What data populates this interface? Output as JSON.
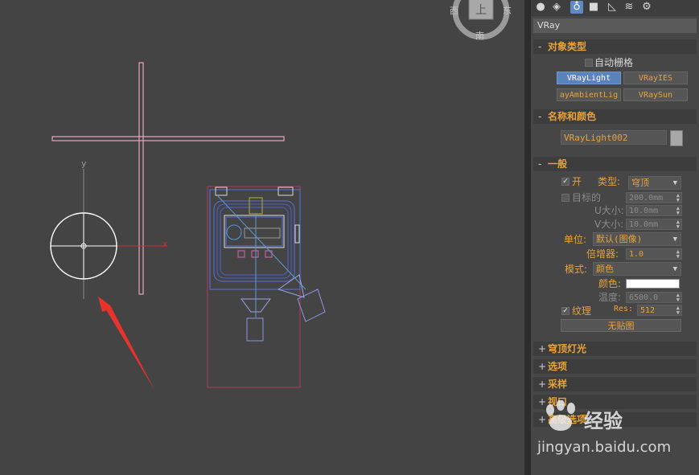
{
  "viewcube": {
    "west": "西",
    "east": "东",
    "south": "南",
    "face": "上"
  },
  "viewport": {
    "axis_y": "y",
    "axis_x": "x"
  },
  "tabs": [
    {
      "icon": "create-sphere-icon"
    },
    {
      "icon": "shapes-icon"
    },
    {
      "icon": "lights-icon"
    },
    {
      "icon": "cameras-icon"
    },
    {
      "icon": "helpers-icon"
    },
    {
      "icon": "spacewarps-icon"
    },
    {
      "icon": "systems-icon"
    }
  ],
  "category": "VRay",
  "object_type": {
    "header": "对象类型",
    "autogrid": "自动栅格",
    "buttons": [
      "VRayLight",
      "VRayIES",
      "ayAmbientLig",
      "VRaySun"
    ]
  },
  "name_color": {
    "header": "名称和颜色",
    "name": "VRayLight002"
  },
  "general": {
    "header": "一般",
    "on": "开",
    "type_label": "类型:",
    "type_value": "穹顶",
    "targeted": "目标的",
    "targeted_value": "200.0mm",
    "u_size": "U大小:",
    "u_value": "10.0mm",
    "v_size": "V大小:",
    "v_value": "10.0mm",
    "units_label": "单位:",
    "units_value": "默认(图像)",
    "multiplier_label": "倍增器:",
    "multiplier_value": "1.0",
    "mode_label": "模式:",
    "mode_value": "颜色",
    "color_label": "颜色:",
    "temp_label": "温度:",
    "temp_value": "6500.0",
    "texture": "纹理",
    "res_label": "Res:",
    "res_value": "512",
    "nomap": "无贴图"
  },
  "rollouts": [
    "穹顶灯光",
    "选项",
    "采样",
    "视口",
    "高级选项"
  ],
  "watermark": {
    "brand": "经验",
    "url": "jingyan.baidu.com"
  },
  "colors": {
    "accent": "#e8a23c",
    "selected": "#5b82bb",
    "arrow": "#e8322c"
  }
}
